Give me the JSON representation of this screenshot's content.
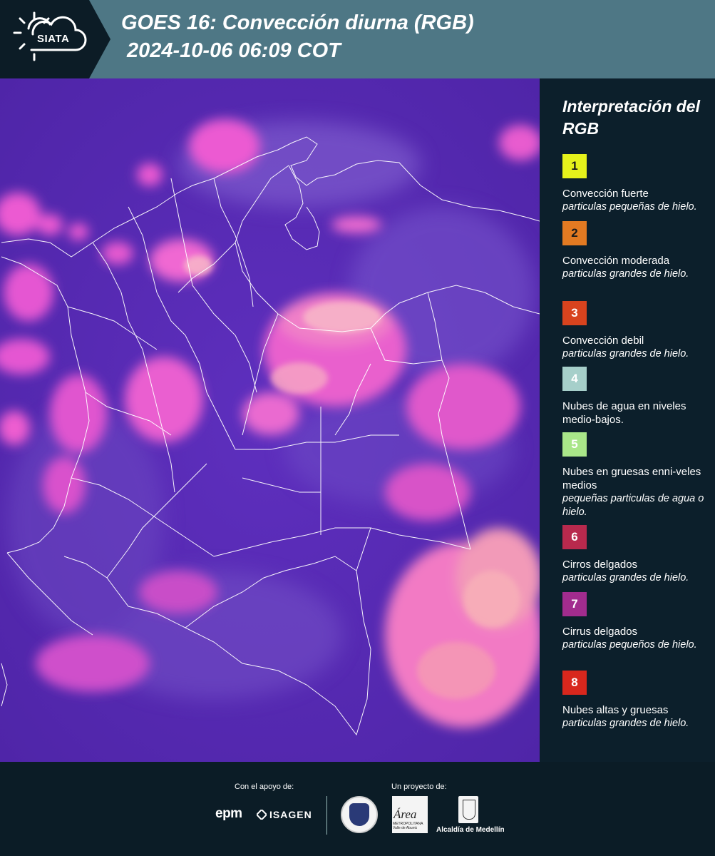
{
  "header": {
    "logo_text": "SIATA",
    "title_line1": "GOES 16: Convección diurna (RGB)",
    "title_line2": "2024-10-06 06:09 COT"
  },
  "map": {
    "background_color": "#5a2fb4",
    "border_color": "#ffffff",
    "cloud_colors": [
      "#e45bd6",
      "#ff7ec4",
      "#f7b3c8",
      "#ff9fa8"
    ]
  },
  "legend": {
    "title": "Interpretación del RGB",
    "items": [
      {
        "number": "1",
        "color": "#e6f21b",
        "label": "Convección fuerte",
        "desc": "particulas pequeñas de hielo."
      },
      {
        "number": "2",
        "color": "#e37a22",
        "label": "Convección moderada",
        "desc": "particulas grandes de hielo."
      },
      {
        "number": "3",
        "color": "#d8431e",
        "label": "Convección debil",
        "desc": "particulas grandes de hielo."
      },
      {
        "number": "4",
        "color": "#a6cfca",
        "label": "Nubes de agua en niveles medio-bajos.",
        "desc": ""
      },
      {
        "number": "5",
        "color": "#a9e689",
        "label": "Nubes en gruesas enni-veles medios",
        "desc": "pequeñas particulas de agua o hielo."
      },
      {
        "number": "6",
        "color": "#b8294d",
        "label": "Cirros delgados",
        "desc": "particulas grandes de hielo."
      },
      {
        "number": "7",
        "color": "#a22c8e",
        "label": "Cirrus delgados",
        "desc": "particulas pequeños de hielo."
      },
      {
        "number": "8",
        "color": "#d8271d",
        "label": "Nubes altas y gruesas",
        "desc": "particulas grandes de hielo."
      }
    ]
  },
  "footer": {
    "support_label": "Con el apoyo de:",
    "project_label": "Un proyecto de:",
    "sponsor1": "epm",
    "sponsor2": "ISAGEN",
    "area_logo_text": "Área",
    "area_logo_sub": "METROPOLITANA Valle de Aburrá",
    "medellin_label": "Alcaldía de Medellín"
  }
}
